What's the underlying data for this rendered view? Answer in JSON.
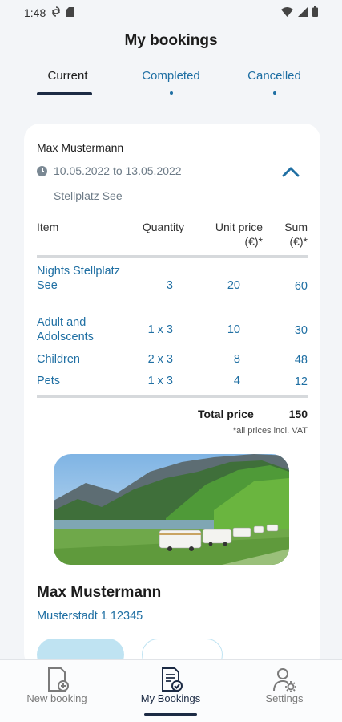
{
  "status_bar": {
    "time": "1:48"
  },
  "title": "My bookings",
  "tabs": [
    {
      "label": "Current",
      "active": true
    },
    {
      "label": "Completed",
      "active": false
    },
    {
      "label": "Cancelled",
      "active": false
    }
  ],
  "booking": {
    "guest_name": "Max Mustermann",
    "dates": "10.05.2022 to 13.05.2022",
    "place": "Stellplatz See",
    "table": {
      "headers": {
        "item": "Item",
        "quantity": "Quantity",
        "unit_price": "Unit price (€)*",
        "sum": "Sum (€)*"
      },
      "rows": [
        {
          "item": "Nights Stellplatz See",
          "quantity": "3",
          "unit_price": "20",
          "sum": "60"
        },
        {
          "item": "Adult and Adolscents",
          "quantity": "1 x 3",
          "unit_price": "10",
          "sum": "30"
        },
        {
          "item": "Children",
          "quantity": "2 x 3",
          "unit_price": "8",
          "sum": "48"
        },
        {
          "item": "Pets",
          "quantity": "1 x 3",
          "unit_price": "4",
          "sum": "12"
        }
      ]
    },
    "total_label": "Total price",
    "total_value": "150",
    "vat_note": "*all prices incl. VAT",
    "host_name": "Max Mustermann",
    "host_address": "Musterstadt 1 12345"
  },
  "bottom_nav": [
    {
      "label": "New booking",
      "icon": "new-booking-icon",
      "active": false
    },
    {
      "label": "My Bookings",
      "icon": "my-bookings-icon",
      "active": true
    },
    {
      "label": "Settings",
      "icon": "settings-icon",
      "active": false
    }
  ],
  "colors": {
    "accent": "#1f6fa3",
    "dark": "#1c2b44",
    "background": "#f3f5f8"
  }
}
